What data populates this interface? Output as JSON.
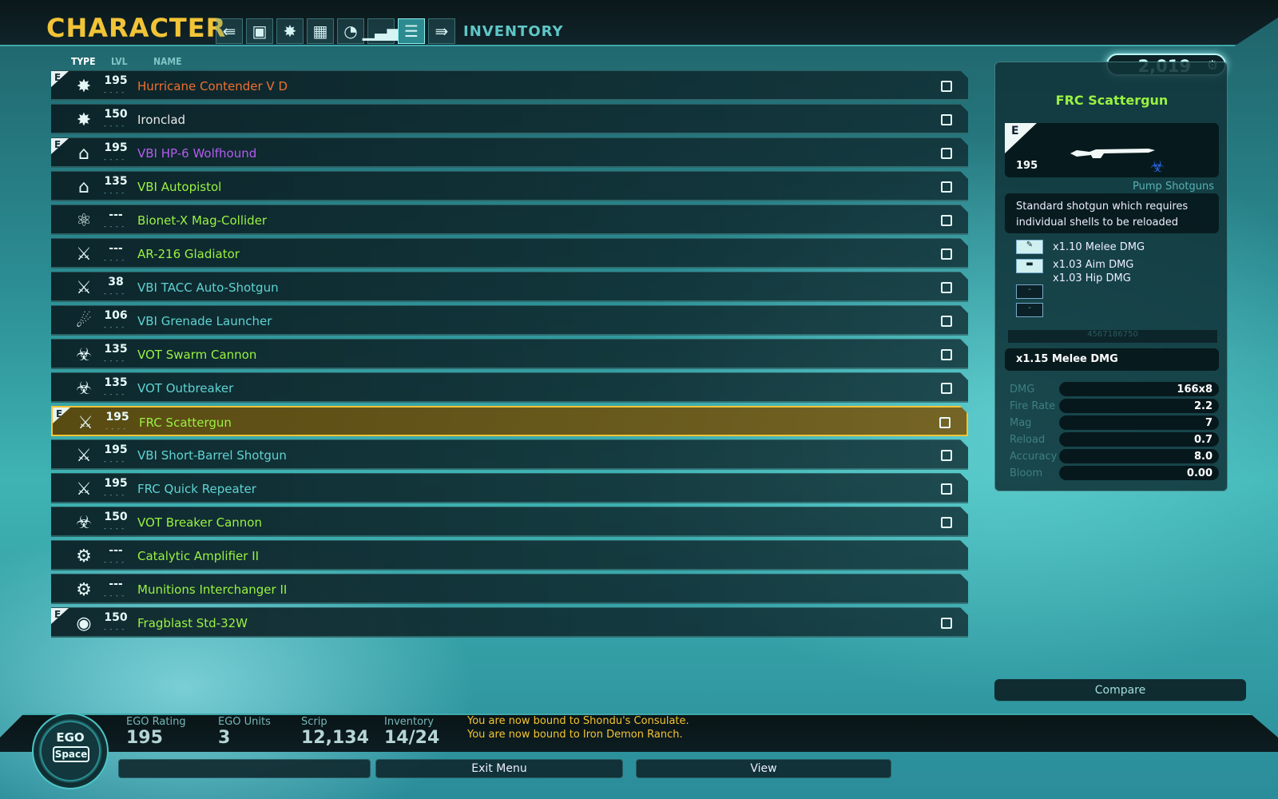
{
  "header": {
    "title": "CHARACTER",
    "section_title": "INVENTORY",
    "nav_icons": [
      "back-icon",
      "briefcase-icon",
      "starburst-icon",
      "grid-icon",
      "gauge-icon",
      "bar-chart-icon",
      "inventory-icon",
      "forward-icon"
    ]
  },
  "list": {
    "headers": {
      "type": "TYPE",
      "lvl": "LVL",
      "name": "NAME"
    },
    "rows": [
      {
        "name": "Hurricane Contender V D",
        "lvl": "195",
        "e": true,
        "color": "#f06f2f",
        "icon": "shield-icon",
        "checkbox": true
      },
      {
        "name": "Ironclad",
        "lvl": "150",
        "e": false,
        "color": "#e8e8e8",
        "icon": "shield-icon",
        "checkbox": true
      },
      {
        "name": "VBI HP-6 Wolfhound",
        "lvl": "195",
        "e": true,
        "color": "#b45cf0",
        "icon": "pistol-icon",
        "checkbox": true
      },
      {
        "name": "VBI Autopistol",
        "lvl": "135",
        "e": false,
        "color": "#9af241",
        "icon": "pistol-icon",
        "checkbox": true
      },
      {
        "name": "Bionet-X Mag-Collider",
        "lvl": "---",
        "e": false,
        "color": "#9af241",
        "icon": "collider-icon",
        "checkbox": true
      },
      {
        "name": "AR-216 Gladiator",
        "lvl": "---",
        "e": false,
        "color": "#9af241",
        "icon": "rifle-icon",
        "checkbox": true
      },
      {
        "name": "VBI TACC Auto-Shotgun",
        "lvl": "38",
        "e": false,
        "color": "#5fd3d3",
        "icon": "shotgun-icon",
        "checkbox": true
      },
      {
        "name": "VBI Grenade Launcher",
        "lvl": "106",
        "e": false,
        "color": "#5fd3d3",
        "icon": "launcher-icon",
        "checkbox": true
      },
      {
        "name": "VOT Swarm Cannon",
        "lvl": "135",
        "e": false,
        "color": "#9af241",
        "icon": "cannon-icon",
        "checkbox": true
      },
      {
        "name": "VOT Outbreaker",
        "lvl": "135",
        "e": false,
        "color": "#5fd3d3",
        "icon": "cannon-icon",
        "checkbox": true
      },
      {
        "name": "FRC Scattergun",
        "lvl": "195",
        "e": true,
        "color": "#9af241",
        "icon": "shotgun-icon",
        "checkbox": true,
        "selected": true
      },
      {
        "name": "VBI Short-Barrel Shotgun",
        "lvl": "195",
        "e": false,
        "color": "#5fd3d3",
        "icon": "shotgun-icon",
        "checkbox": true
      },
      {
        "name": "FRC Quick Repeater",
        "lvl": "195",
        "e": false,
        "color": "#5fd3d3",
        "icon": "rifle-icon",
        "checkbox": true
      },
      {
        "name": "VOT Breaker Cannon",
        "lvl": "150",
        "e": false,
        "color": "#9af241",
        "icon": "cannon-icon",
        "checkbox": true
      },
      {
        "name": "Catalytic Amplifier II",
        "lvl": "---",
        "e": false,
        "color": "#9af241",
        "icon": "mod-icon",
        "checkbox": false
      },
      {
        "name": "Munitions Interchanger II",
        "lvl": "---",
        "e": false,
        "color": "#9af241",
        "icon": "mod-icon",
        "checkbox": false
      },
      {
        "name": "Fragblast Std-32W",
        "lvl": "150",
        "e": true,
        "color": "#9af241",
        "icon": "grenade-icon",
        "checkbox": true
      }
    ]
  },
  "detail": {
    "currency": "2,019",
    "name": "FRC Scattergun",
    "badge": "E",
    "level": "195",
    "category": "Pump Shotguns",
    "description": "Standard shotgun which requires individual shells to be reloaded",
    "mods": [
      "x1.10 Melee DMG",
      "x1.03 Aim DMG",
      "x1.03 Hip DMG"
    ],
    "serial": "4567186750",
    "bonus": "x1.15 Melee DMG",
    "stats": [
      {
        "label": "DMG",
        "value": "166x8"
      },
      {
        "label": "Fire Rate",
        "value": "2.2"
      },
      {
        "label": "Mag",
        "value": "7"
      },
      {
        "label": "Reload",
        "value": "0.7"
      },
      {
        "label": "Accuracy",
        "value": "8.0"
      },
      {
        "label": "Bloom",
        "value": "0.00"
      }
    ],
    "compare": "Compare"
  },
  "footer": {
    "ego": "EGO",
    "space": "Space",
    "ego_rating_label": "EGO Rating",
    "ego_rating": "195",
    "ego_units_label": "EGO Units",
    "ego_units": "3",
    "scrip_label": "Scrip",
    "scrip": "12,134",
    "inventory_label": "Inventory",
    "inventory": "14/24",
    "messages": [
      "You are now bound to Shondu's Consulate.",
      "You are now bound to Iron Demon Ranch."
    ],
    "exit_menu": "Exit Menu",
    "view": "View"
  },
  "colors": {
    "accent": "#f1c437",
    "selected": "#f3c438",
    "teal": "#3fb3b3"
  }
}
